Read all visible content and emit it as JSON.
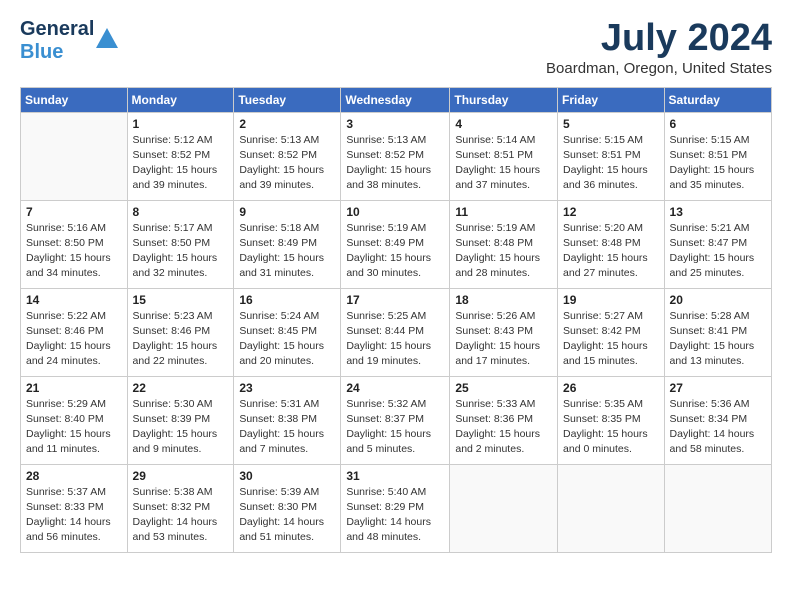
{
  "header": {
    "logo_general": "General",
    "logo_blue": "Blue",
    "title": "July 2024",
    "subtitle": "Boardman, Oregon, United States"
  },
  "calendar": {
    "days_of_week": [
      "Sunday",
      "Monday",
      "Tuesday",
      "Wednesday",
      "Thursday",
      "Friday",
      "Saturday"
    ],
    "weeks": [
      [
        {
          "day": "",
          "info": ""
        },
        {
          "day": "1",
          "info": "Sunrise: 5:12 AM\nSunset: 8:52 PM\nDaylight: 15 hours\nand 39 minutes."
        },
        {
          "day": "2",
          "info": "Sunrise: 5:13 AM\nSunset: 8:52 PM\nDaylight: 15 hours\nand 39 minutes."
        },
        {
          "day": "3",
          "info": "Sunrise: 5:13 AM\nSunset: 8:52 PM\nDaylight: 15 hours\nand 38 minutes."
        },
        {
          "day": "4",
          "info": "Sunrise: 5:14 AM\nSunset: 8:51 PM\nDaylight: 15 hours\nand 37 minutes."
        },
        {
          "day": "5",
          "info": "Sunrise: 5:15 AM\nSunset: 8:51 PM\nDaylight: 15 hours\nand 36 minutes."
        },
        {
          "day": "6",
          "info": "Sunrise: 5:15 AM\nSunset: 8:51 PM\nDaylight: 15 hours\nand 35 minutes."
        }
      ],
      [
        {
          "day": "7",
          "info": "Sunrise: 5:16 AM\nSunset: 8:50 PM\nDaylight: 15 hours\nand 34 minutes."
        },
        {
          "day": "8",
          "info": "Sunrise: 5:17 AM\nSunset: 8:50 PM\nDaylight: 15 hours\nand 32 minutes."
        },
        {
          "day": "9",
          "info": "Sunrise: 5:18 AM\nSunset: 8:49 PM\nDaylight: 15 hours\nand 31 minutes."
        },
        {
          "day": "10",
          "info": "Sunrise: 5:19 AM\nSunset: 8:49 PM\nDaylight: 15 hours\nand 30 minutes."
        },
        {
          "day": "11",
          "info": "Sunrise: 5:19 AM\nSunset: 8:48 PM\nDaylight: 15 hours\nand 28 minutes."
        },
        {
          "day": "12",
          "info": "Sunrise: 5:20 AM\nSunset: 8:48 PM\nDaylight: 15 hours\nand 27 minutes."
        },
        {
          "day": "13",
          "info": "Sunrise: 5:21 AM\nSunset: 8:47 PM\nDaylight: 15 hours\nand 25 minutes."
        }
      ],
      [
        {
          "day": "14",
          "info": "Sunrise: 5:22 AM\nSunset: 8:46 PM\nDaylight: 15 hours\nand 24 minutes."
        },
        {
          "day": "15",
          "info": "Sunrise: 5:23 AM\nSunset: 8:46 PM\nDaylight: 15 hours\nand 22 minutes."
        },
        {
          "day": "16",
          "info": "Sunrise: 5:24 AM\nSunset: 8:45 PM\nDaylight: 15 hours\nand 20 minutes."
        },
        {
          "day": "17",
          "info": "Sunrise: 5:25 AM\nSunset: 8:44 PM\nDaylight: 15 hours\nand 19 minutes."
        },
        {
          "day": "18",
          "info": "Sunrise: 5:26 AM\nSunset: 8:43 PM\nDaylight: 15 hours\nand 17 minutes."
        },
        {
          "day": "19",
          "info": "Sunrise: 5:27 AM\nSunset: 8:42 PM\nDaylight: 15 hours\nand 15 minutes."
        },
        {
          "day": "20",
          "info": "Sunrise: 5:28 AM\nSunset: 8:41 PM\nDaylight: 15 hours\nand 13 minutes."
        }
      ],
      [
        {
          "day": "21",
          "info": "Sunrise: 5:29 AM\nSunset: 8:40 PM\nDaylight: 15 hours\nand 11 minutes."
        },
        {
          "day": "22",
          "info": "Sunrise: 5:30 AM\nSunset: 8:39 PM\nDaylight: 15 hours\nand 9 minutes."
        },
        {
          "day": "23",
          "info": "Sunrise: 5:31 AM\nSunset: 8:38 PM\nDaylight: 15 hours\nand 7 minutes."
        },
        {
          "day": "24",
          "info": "Sunrise: 5:32 AM\nSunset: 8:37 PM\nDaylight: 15 hours\nand 5 minutes."
        },
        {
          "day": "25",
          "info": "Sunrise: 5:33 AM\nSunset: 8:36 PM\nDaylight: 15 hours\nand 2 minutes."
        },
        {
          "day": "26",
          "info": "Sunrise: 5:35 AM\nSunset: 8:35 PM\nDaylight: 15 hours\nand 0 minutes."
        },
        {
          "day": "27",
          "info": "Sunrise: 5:36 AM\nSunset: 8:34 PM\nDaylight: 14 hours\nand 58 minutes."
        }
      ],
      [
        {
          "day": "28",
          "info": "Sunrise: 5:37 AM\nSunset: 8:33 PM\nDaylight: 14 hours\nand 56 minutes."
        },
        {
          "day": "29",
          "info": "Sunrise: 5:38 AM\nSunset: 8:32 PM\nDaylight: 14 hours\nand 53 minutes."
        },
        {
          "day": "30",
          "info": "Sunrise: 5:39 AM\nSunset: 8:30 PM\nDaylight: 14 hours\nand 51 minutes."
        },
        {
          "day": "31",
          "info": "Sunrise: 5:40 AM\nSunset: 8:29 PM\nDaylight: 14 hours\nand 48 minutes."
        },
        {
          "day": "",
          "info": ""
        },
        {
          "day": "",
          "info": ""
        },
        {
          "day": "",
          "info": ""
        }
      ]
    ]
  }
}
